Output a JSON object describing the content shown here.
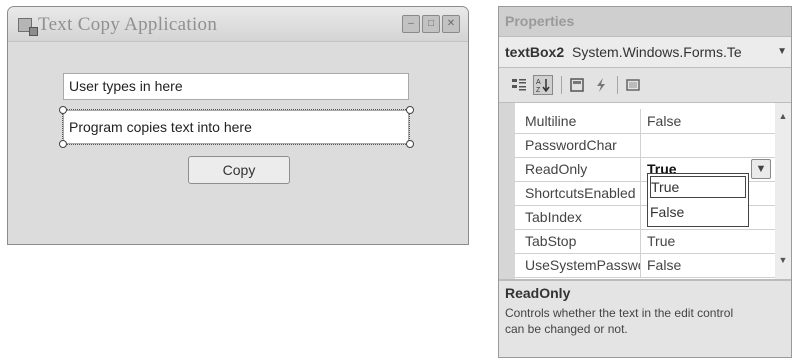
{
  "form_window": {
    "title": "Text Copy Application",
    "window_controls": [
      "minimize-icon",
      "maximize-icon",
      "close-icon"
    ],
    "textbox1_text": "User types in here",
    "textbox2_text": "Program copies text into here",
    "copy_button_label": "Copy"
  },
  "properties_panel": {
    "title": "Properties",
    "selected_object": {
      "name": "textBox2",
      "type": "System.Windows.Forms.Te"
    },
    "toolbar_icons": [
      "categorized-icon",
      "alphabetical-icon",
      "properties-icon",
      "events-icon",
      "property-pages-icon"
    ],
    "rows": [
      {
        "name": "Multiline",
        "value": "False"
      },
      {
        "name": "PasswordChar",
        "value": ""
      },
      {
        "name": "ReadOnly",
        "value": "True"
      },
      {
        "name": "ShortcutsEnabled",
        "value": "True"
      },
      {
        "name": "TabIndex",
        "value": ""
      },
      {
        "name": "TabStop",
        "value": "True"
      },
      {
        "name": "UseSystemPasswo",
        "value": "False"
      }
    ],
    "dropdown_options": [
      "True",
      "False"
    ],
    "description_title": "ReadOnly",
    "description_text": "Controls whether the text in the edit control can be changed or not."
  }
}
